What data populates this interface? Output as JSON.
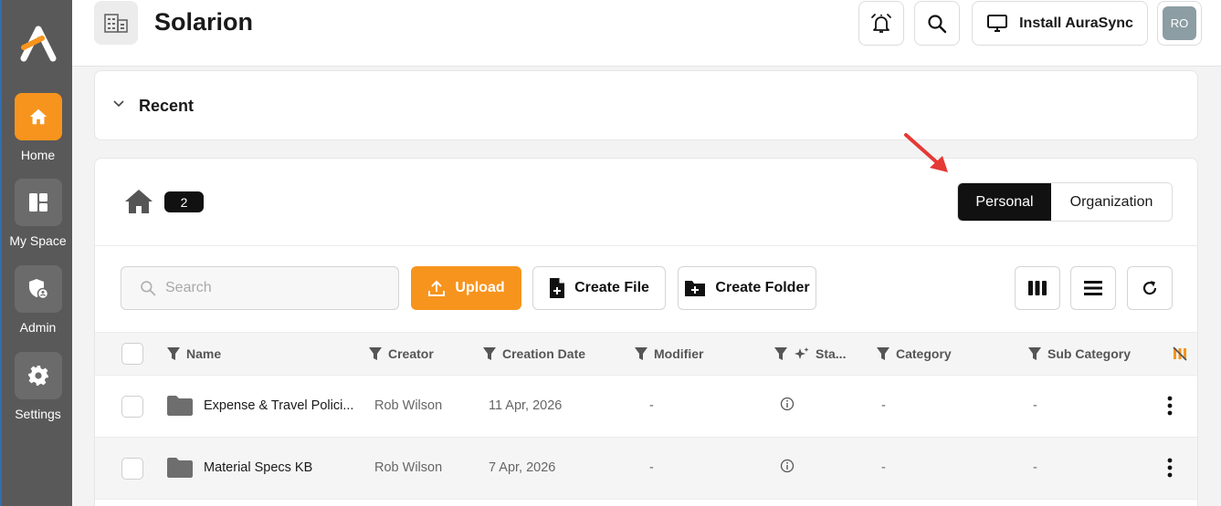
{
  "app": {
    "title": "Solarion"
  },
  "sidebar": {
    "items": [
      {
        "label": "Home",
        "icon": "home-icon",
        "active": true
      },
      {
        "label": "My Space",
        "icon": "dashboard-icon",
        "active": false
      },
      {
        "label": "Admin",
        "icon": "admin-shield-icon",
        "active": false
      },
      {
        "label": "Settings",
        "icon": "gear-icon",
        "active": false
      }
    ]
  },
  "header": {
    "install_label": "Install AuraSync",
    "avatar_initials": "RO"
  },
  "recent": {
    "label": "Recent"
  },
  "breadcrumb": {
    "count": "2"
  },
  "scope_toggle": {
    "personal": "Personal",
    "organization": "Organization",
    "selected": "Personal"
  },
  "toolbar": {
    "search_placeholder": "Search",
    "upload_label": "Upload",
    "create_file_label": "Create File",
    "create_folder_label": "Create Folder"
  },
  "table": {
    "columns": [
      "Name",
      "Creator",
      "Creation Date",
      "Modifier",
      "Sta...",
      "Category",
      "Sub Category"
    ],
    "rows": [
      {
        "name": "Expense & Travel Polici...",
        "creator": "Rob Wilson",
        "creation_date": "11 Apr, 2026",
        "modifier": "-",
        "category": "-",
        "sub_category": "-"
      },
      {
        "name": "Material Specs KB",
        "creator": "Rob Wilson",
        "creation_date": "7 Apr, 2026",
        "modifier": "-",
        "category": "-",
        "sub_category": "-"
      }
    ]
  },
  "colors": {
    "accent": "#f7941d",
    "sidebar": "#595959",
    "dark": "#111111",
    "annotation_arrow": "#e53935"
  }
}
